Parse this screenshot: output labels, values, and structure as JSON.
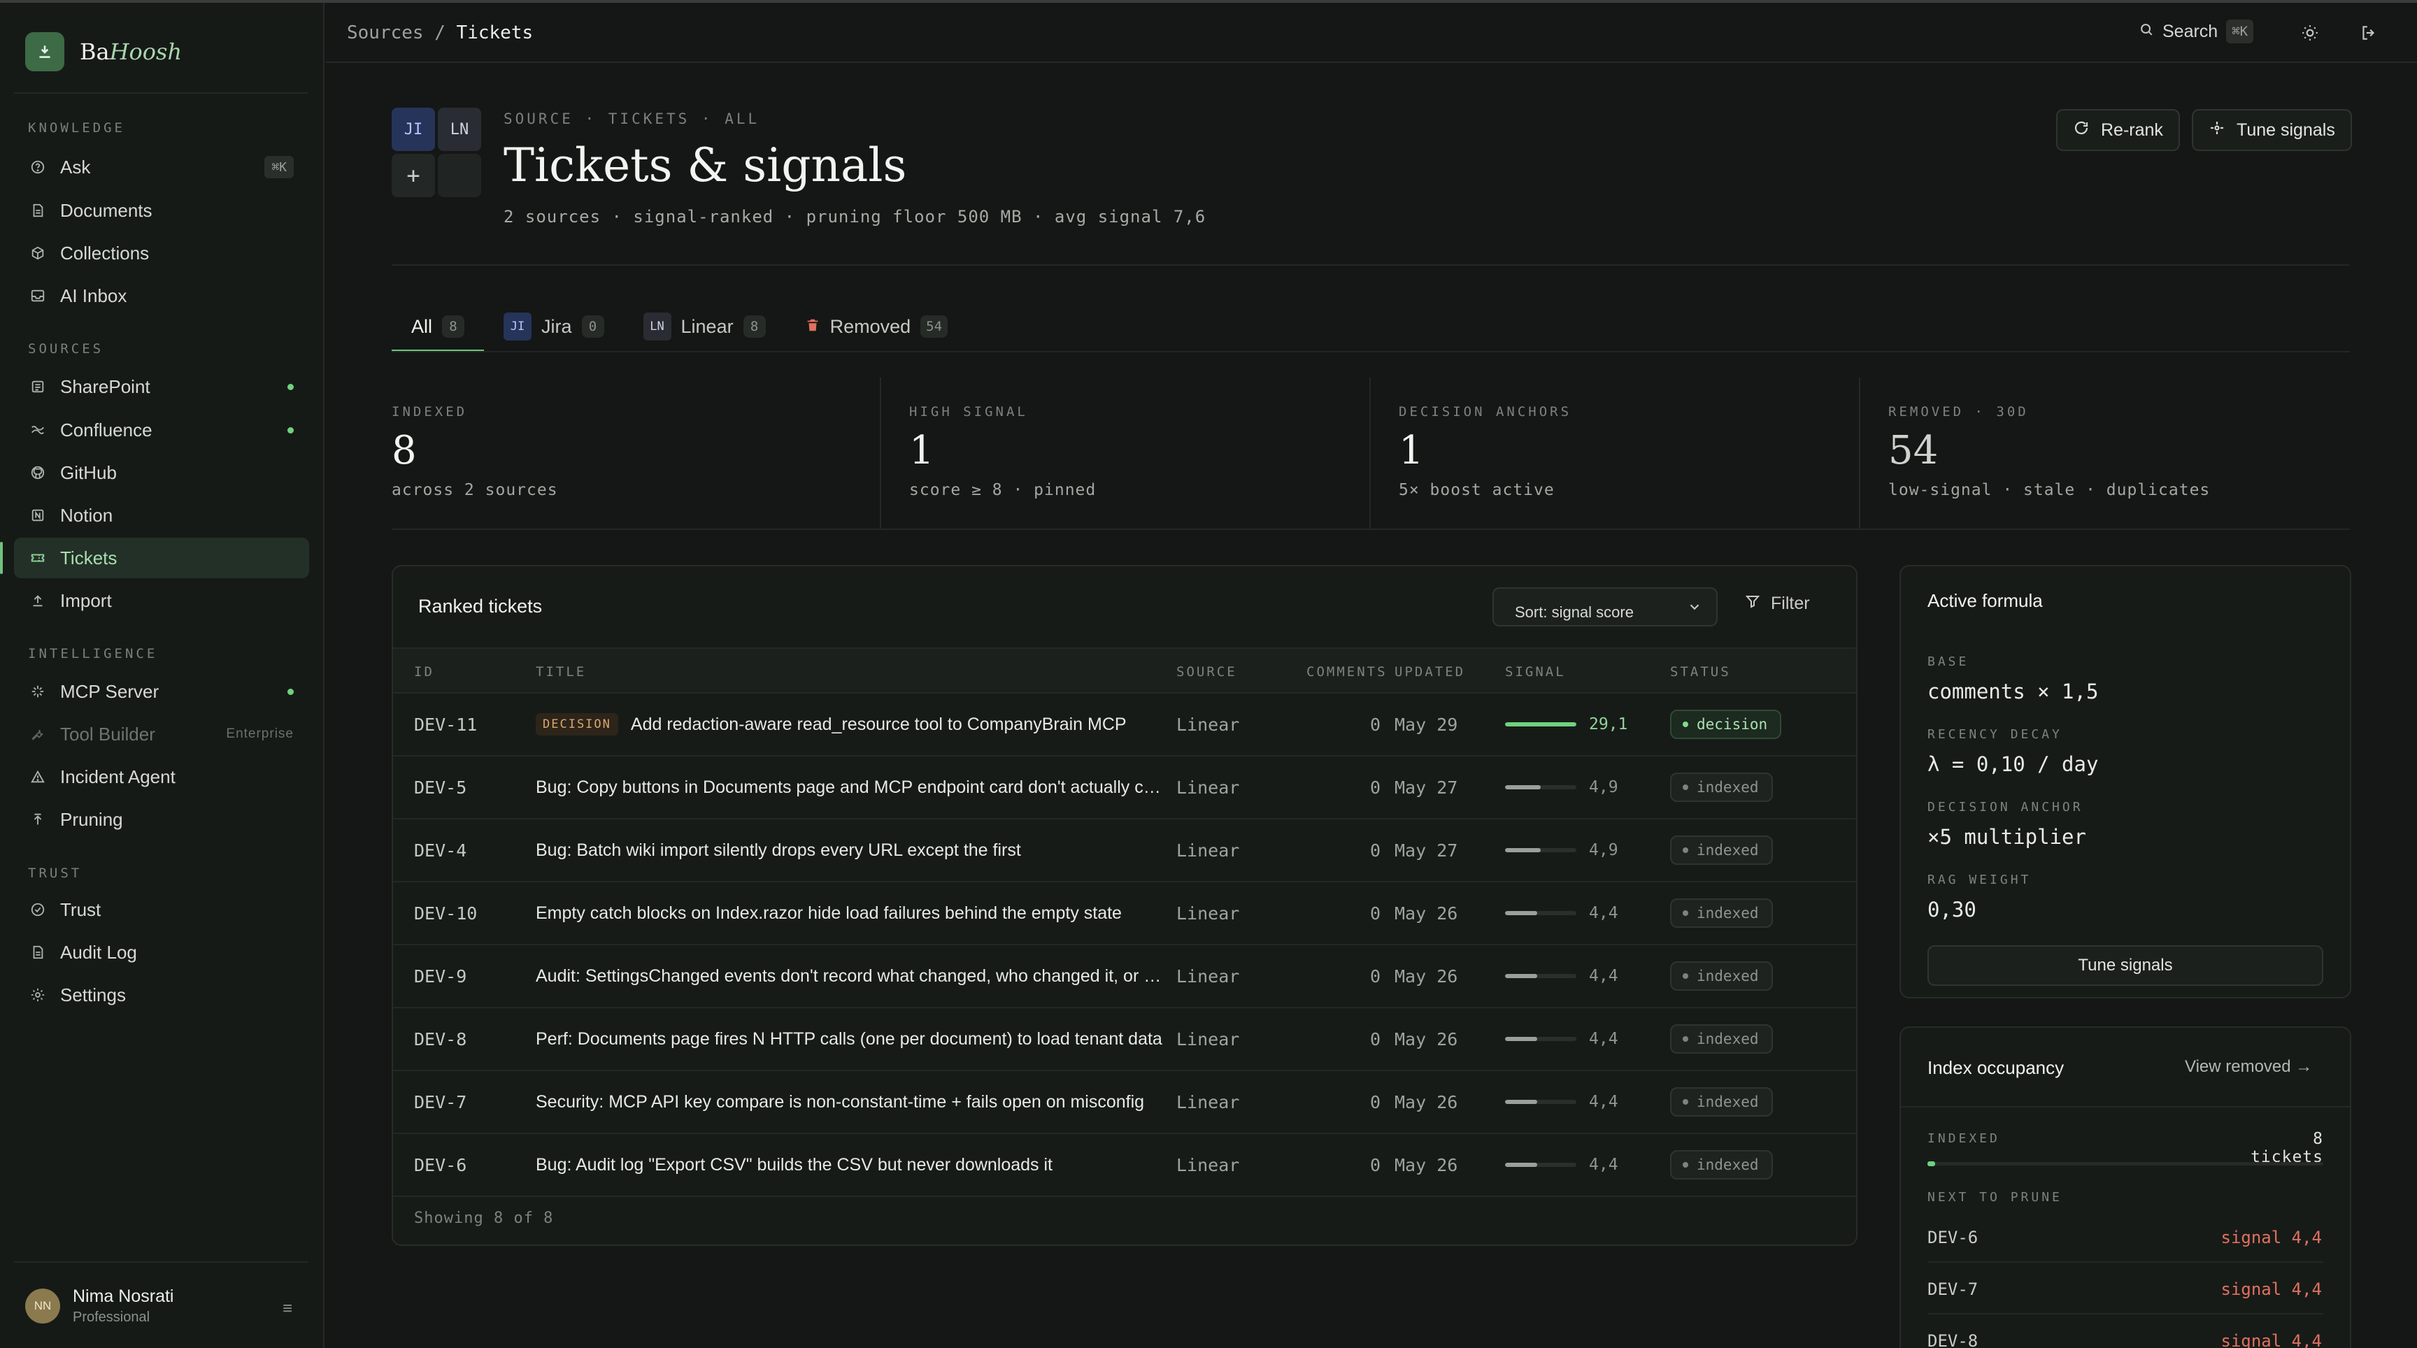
{
  "brand": {
    "name_plain": "Ba",
    "name_italic": "Hoosh"
  },
  "sidebar": {
    "sections": [
      {
        "label": "KNOWLEDGE"
      },
      {
        "label": "SOURCES"
      },
      {
        "label": "INTELLIGENCE"
      },
      {
        "label": "TRUST"
      }
    ],
    "knowledge": [
      {
        "label": "Ask",
        "kbd": "⌘K"
      },
      {
        "label": "Documents"
      },
      {
        "label": "Collections"
      },
      {
        "label": "AI Inbox"
      }
    ],
    "sources": [
      {
        "label": "SharePoint",
        "status": "connected"
      },
      {
        "label": "Confluence",
        "status": "connected"
      },
      {
        "label": "GitHub"
      },
      {
        "label": "Notion"
      },
      {
        "label": "Tickets",
        "active": true
      },
      {
        "label": "Import"
      }
    ],
    "intelligence": [
      {
        "label": "MCP Server",
        "status": "connected"
      },
      {
        "label": "Tool Builder",
        "tag": "Enterprise",
        "disabled": true
      },
      {
        "label": "Incident Agent"
      },
      {
        "label": "Pruning"
      }
    ],
    "trust": [
      {
        "label": "Trust"
      },
      {
        "label": "Audit Log"
      },
      {
        "label": "Settings"
      }
    ],
    "user": {
      "initials": "NN",
      "name": "Nima Nosrati",
      "plan": "Professional"
    }
  },
  "topbar": {
    "breadcrumb_parent": "Sources",
    "breadcrumb_sep": "/",
    "breadcrumb_current": "Tickets",
    "search_label": "Search",
    "search_kbd": "⌘K"
  },
  "header": {
    "tiles": {
      "ji": "JI",
      "ln": "LN",
      "plus": "+"
    },
    "eyebrow": "SOURCE · TICKETS · ALL",
    "title": "Tickets & signals",
    "subtitle": "2 sources · signal-ranked · pruning floor 500 MB · avg signal 7,6",
    "rerank_label": "Re-rank",
    "tune_label": "Tune signals"
  },
  "tabs": [
    {
      "label": "All",
      "count": "8",
      "active": true
    },
    {
      "label": "Jira",
      "count": "0",
      "badge": "JI"
    },
    {
      "label": "Linear",
      "count": "8",
      "badge": "LN"
    },
    {
      "label": "Removed",
      "count": "54"
    }
  ],
  "stats": [
    {
      "label": "INDEXED",
      "value": "8",
      "desc": "across 2 sources"
    },
    {
      "label": "HIGH SIGNAL",
      "value": "1",
      "desc": "score ≥ 8 · pinned"
    },
    {
      "label": "DECISION ANCHORS",
      "value": "1",
      "desc": "5× boost active"
    },
    {
      "label": "REMOVED · 30D",
      "value": "54",
      "desc": "low-signal · stale · duplicates"
    }
  ],
  "ranked": {
    "title": "Ranked tickets",
    "sort_label": "Sort: signal score",
    "filter_label": "Filter",
    "columns": [
      "ID",
      "TITLE",
      "SOURCE",
      "COMMENTS",
      "UPDATED",
      "SIGNAL",
      "STATUS"
    ],
    "rows": [
      {
        "id": "DEV-11",
        "tag": "DECISION",
        "title": "Add redaction-aware read_resource tool to CompanyBrain MCP",
        "source": "Linear",
        "comments": "0",
        "updated": "May 29",
        "signal": "29,1",
        "signal_fraction": 1.0,
        "status": "decision"
      },
      {
        "id": "DEV-5",
        "title": "Bug: Copy buttons in Documents page and MCP endpoint card don't actually copy",
        "source": "Linear",
        "comments": "0",
        "updated": "May 27",
        "signal": "4,9",
        "signal_fraction": 0.5,
        "status": "indexed"
      },
      {
        "id": "DEV-4",
        "title": "Bug: Batch wiki import silently drops every URL except the first",
        "source": "Linear",
        "comments": "0",
        "updated": "May 27",
        "signal": "4,9",
        "signal_fraction": 0.5,
        "status": "indexed"
      },
      {
        "id": "DEV-10",
        "title": "Empty catch blocks on Index.razor hide load failures behind the empty state",
        "source": "Linear",
        "comments": "0",
        "updated": "May 26",
        "signal": "4,4",
        "signal_fraction": 0.45,
        "status": "indexed"
      },
      {
        "id": "DEV-9",
        "title": "Audit: SettingsChanged events don't record what changed, who changed it, or when",
        "source": "Linear",
        "comments": "0",
        "updated": "May 26",
        "signal": "4,4",
        "signal_fraction": 0.45,
        "status": "indexed"
      },
      {
        "id": "DEV-8",
        "title": "Perf: Documents page fires N HTTP calls (one per document) to load tenant data",
        "source": "Linear",
        "comments": "0",
        "updated": "May 26",
        "signal": "4,4",
        "signal_fraction": 0.45,
        "status": "indexed"
      },
      {
        "id": "DEV-7",
        "title": "Security: MCP API key compare is non-constant-time + fails open on misconfig",
        "source": "Linear",
        "comments": "0",
        "updated": "May 26",
        "signal": "4,4",
        "signal_fraction": 0.45,
        "status": "indexed"
      },
      {
        "id": "DEV-6",
        "title": "Bug: Audit log \"Export CSV\" builds the CSV but never downloads it",
        "source": "Linear",
        "comments": "0",
        "updated": "May 26",
        "signal": "4,4",
        "signal_fraction": 0.45,
        "status": "indexed"
      }
    ],
    "footer": "Showing 8 of 8"
  },
  "formula": {
    "title": "Active formula",
    "items": [
      {
        "label": "BASE",
        "value": "comments × 1,5"
      },
      {
        "label": "RECENCY DECAY",
        "value": "λ = 0,10 / day"
      },
      {
        "label": "DECISION ANCHOR",
        "value": "×5 multiplier"
      },
      {
        "label": "RAG WEIGHT",
        "value": "0,30"
      }
    ],
    "button": "Tune signals"
  },
  "occupancy": {
    "title": "Index occupancy",
    "view_removed": "View removed →",
    "indexed_label": "INDEXED",
    "indexed_count": "8 tickets",
    "fill_fraction": 0.02,
    "next_label": "NEXT TO PRUNE",
    "next": [
      {
        "id": "DEV-6",
        "signal": "signal 4,4"
      },
      {
        "id": "DEV-7",
        "signal": "signal 4,4"
      },
      {
        "id": "DEV-8",
        "signal": "signal 4,4"
      }
    ]
  },
  "colors": {
    "accent": "#6fc27d",
    "danger": "#e0715f",
    "decision": "#d9a86c"
  }
}
